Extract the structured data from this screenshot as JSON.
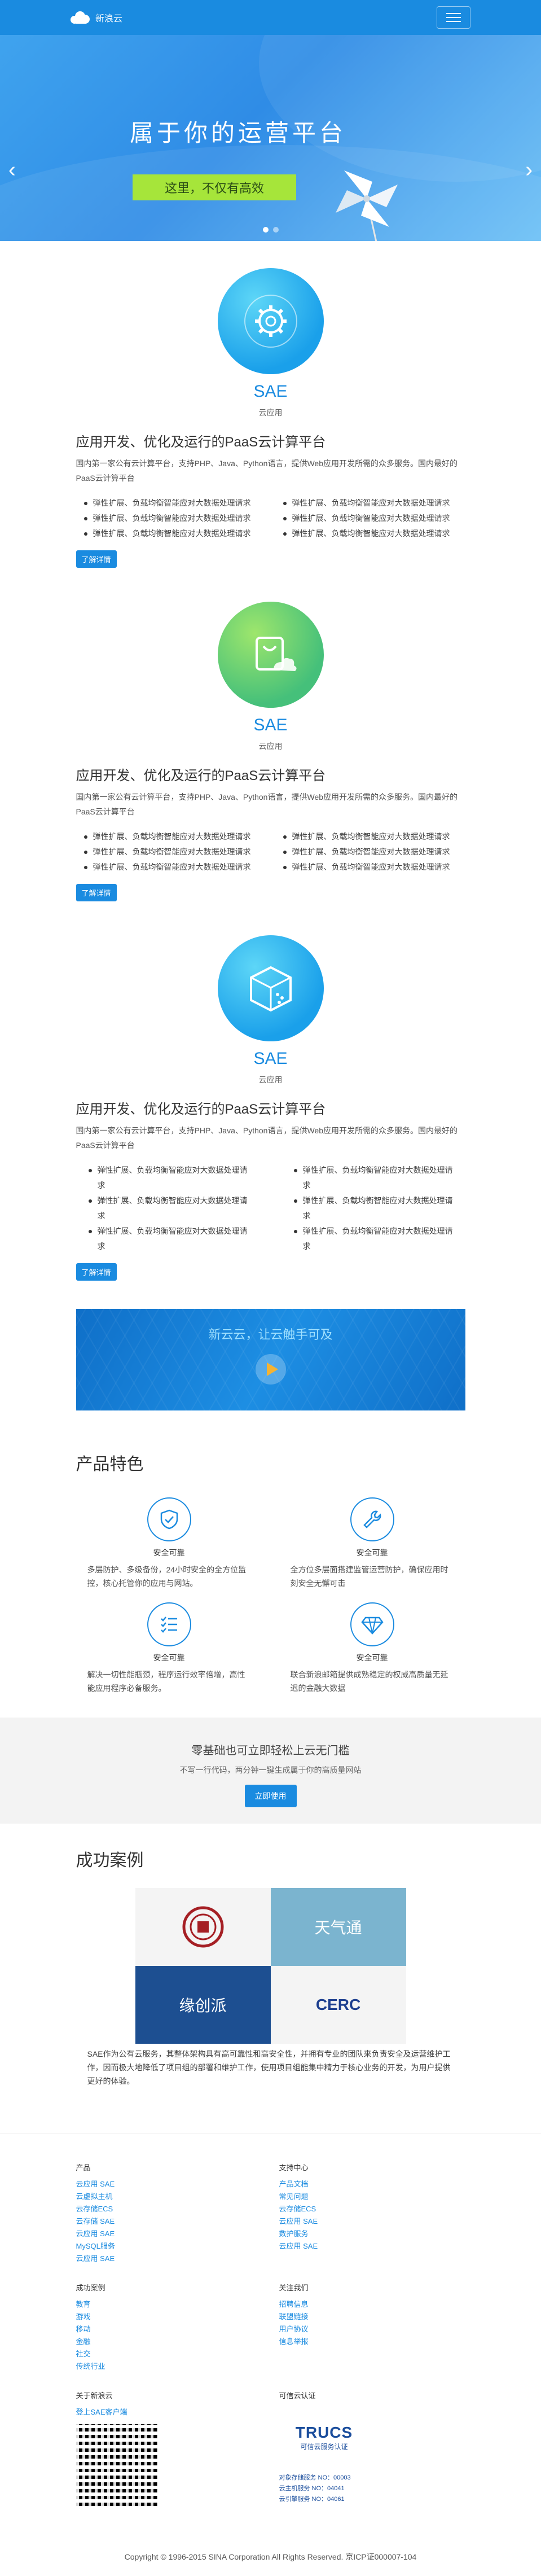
{
  "header": {
    "brand": "新浪云"
  },
  "hero": {
    "title": "属于你的运营平台",
    "tag": "这里，不仅有高效"
  },
  "products": [
    {
      "name": "SAE",
      "subtitle": "云应用",
      "heading": "应用开发、优化及运行的PaaS云计算平台",
      "description": "国内第一家公有云计算平台，支持PHP、Java、Python语言，提供Web应用开发所需的众多服务。国内最好的PaaS云计算平台",
      "features": [
        "弹性扩展、负载均衡智能应对大数据处理请求",
        "弹性扩展、负载均衡智能应对大数据处理请求",
        "弹性扩展、负载均衡智能应对大数据处理请求",
        "弹性扩展、负载均衡智能应对大数据处理请求",
        "弹性扩展、负载均衡智能应对大数据处理请求",
        "弹性扩展、负载均衡智能应对大数据处理请求"
      ],
      "button": "了解详情"
    },
    {
      "name": "SAE",
      "subtitle": "云应用",
      "heading": "应用开发、优化及运行的PaaS云计算平台",
      "description": "国内第一家公有云计算平台，支持PHP、Java、Python语言，提供Web应用开发所需的众多服务。国内最好的PaaS云计算平台",
      "features": [
        "弹性扩展、负载均衡智能应对大数据处理请求",
        "弹性扩展、负载均衡智能应对大数据处理请求",
        "弹性扩展、负载均衡智能应对大数据处理请求",
        "弹性扩展、负载均衡智能应对大数据处理请求",
        "弹性扩展、负载均衡智能应对大数据处理请求",
        "弹性扩展、负载均衡智能应对大数据处理请求"
      ],
      "button": "了解详情"
    },
    {
      "name": "SAE",
      "subtitle": "云应用",
      "heading": "应用开发、优化及运行的PaaS云计算平台",
      "description": "国内第一家公有云计算平台，支持PHP、Java、Python语言，提供Web应用开发所需的众多服务。国内最好的PaaS云计算平台",
      "features": [
        "弹性扩展、负载均衡智能应对大数据处理请求",
        "弹性扩展、负载均衡智能应对大数据处理请求",
        "弹性扩展、负载均衡智能应对大数据处理请求",
        "弹性扩展、负载均衡智能应对大数据处理请求",
        "弹性扩展、负载均衡智能应对大数据处理请求",
        "弹性扩展、负载均衡智能应对大数据处理请求"
      ],
      "button": "了解详情"
    }
  ],
  "video": {
    "title": "新云云，让云触手可及"
  },
  "features_section": {
    "title": "产品特色",
    "items": [
      {
        "icon": "shield-icon",
        "title": "安全可靠",
        "desc": "多层防护、多级备份，24小时安全的全方位监控，核心托管你的应用与网站。"
      },
      {
        "icon": "wrench-icon",
        "title": "安全可靠",
        "desc": "全方位多层面搭建监管运营防护，确保应用时刻安全无懈可击"
      },
      {
        "icon": "checklist-icon",
        "title": "安全可靠",
        "desc": "解决一切性能瓶颈，程序运行效率倍增，高性能应用程序必备服务。"
      },
      {
        "icon": "diamond-icon",
        "title": "安全可靠",
        "desc": "联合新浪邮箱提供成熟稳定的权威高质量无延迟的金融大数据"
      }
    ]
  },
  "cta": {
    "title": "零基础也可立即轻松上云无门槛",
    "subtitle": "不写一行代码，两分钟一键生成属于你的高质量网站",
    "button": "立即使用"
  },
  "cases": {
    "title": "成功案例",
    "logos": [
      "",
      "天气通",
      "缘创派",
      "CERC"
    ],
    "text": "SAE作为公有云服务，其整体架构具有高可靠性和高安全性，并拥有专业的团队来负责安全及运营维护工作，因而极大地降低了项目组的部署和维护工作，使用项目组能集中精力于核心业务的开发，为用户提供更好的体验。"
  },
  "footer": {
    "cols": [
      {
        "title": "产品",
        "links": [
          "云应用 SAE",
          "云虚拟主机",
          "云存储ECS",
          "云存储 SAE",
          "云应用 SAE",
          "MySQL服务",
          "云应用 SAE"
        ]
      },
      {
        "title": "支持中心",
        "links": [
          "产品文档",
          "常见问题",
          "云存储ECS",
          "云应用 SAE",
          "数护服务",
          "云应用 SAE"
        ]
      },
      {
        "title": "成功案例",
        "links": [
          "教育",
          "游戏",
          "移动",
          "金融",
          "社交",
          "传统行业"
        ]
      },
      {
        "title": "关注我们",
        "links": [
          "招聘信息",
          "联盟链接",
          "用户协议",
          "信息举报"
        ]
      },
      {
        "title": "关于新浪云",
        "links": [
          "登上SAE客户端"
        ]
      },
      {
        "title": "可信云认证",
        "links": []
      }
    ],
    "trust_mark": "TRUCS",
    "trust_sub": "可信云服务认证",
    "registrations": [
      "对象存储服务 NO：00003",
      "云主机服务 NO：04041",
      "云引擎服务 NO：04061"
    ],
    "copyright": "Copyright © 1996-2015 SINA Corporation All Rights Reserved. 京ICP证000007-104"
  }
}
